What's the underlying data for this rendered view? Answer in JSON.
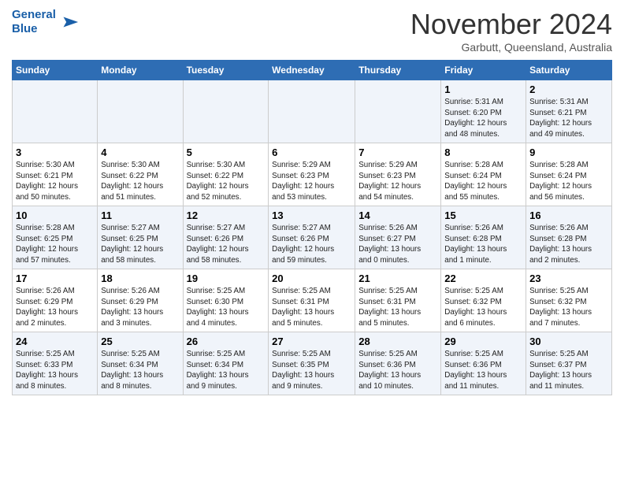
{
  "logo": {
    "line1": "General",
    "line2": "Blue"
  },
  "title": "November 2024",
  "location": "Garbutt, Queensland, Australia",
  "weekdays": [
    "Sunday",
    "Monday",
    "Tuesday",
    "Wednesday",
    "Thursday",
    "Friday",
    "Saturday"
  ],
  "weeks": [
    [
      {
        "day": "",
        "info": ""
      },
      {
        "day": "",
        "info": ""
      },
      {
        "day": "",
        "info": ""
      },
      {
        "day": "",
        "info": ""
      },
      {
        "day": "",
        "info": ""
      },
      {
        "day": "1",
        "info": "Sunrise: 5:31 AM\nSunset: 6:20 PM\nDaylight: 12 hours\nand 48 minutes."
      },
      {
        "day": "2",
        "info": "Sunrise: 5:31 AM\nSunset: 6:21 PM\nDaylight: 12 hours\nand 49 minutes."
      }
    ],
    [
      {
        "day": "3",
        "info": "Sunrise: 5:30 AM\nSunset: 6:21 PM\nDaylight: 12 hours\nand 50 minutes."
      },
      {
        "day": "4",
        "info": "Sunrise: 5:30 AM\nSunset: 6:22 PM\nDaylight: 12 hours\nand 51 minutes."
      },
      {
        "day": "5",
        "info": "Sunrise: 5:30 AM\nSunset: 6:22 PM\nDaylight: 12 hours\nand 52 minutes."
      },
      {
        "day": "6",
        "info": "Sunrise: 5:29 AM\nSunset: 6:23 PM\nDaylight: 12 hours\nand 53 minutes."
      },
      {
        "day": "7",
        "info": "Sunrise: 5:29 AM\nSunset: 6:23 PM\nDaylight: 12 hours\nand 54 minutes."
      },
      {
        "day": "8",
        "info": "Sunrise: 5:28 AM\nSunset: 6:24 PM\nDaylight: 12 hours\nand 55 minutes."
      },
      {
        "day": "9",
        "info": "Sunrise: 5:28 AM\nSunset: 6:24 PM\nDaylight: 12 hours\nand 56 minutes."
      }
    ],
    [
      {
        "day": "10",
        "info": "Sunrise: 5:28 AM\nSunset: 6:25 PM\nDaylight: 12 hours\nand 57 minutes."
      },
      {
        "day": "11",
        "info": "Sunrise: 5:27 AM\nSunset: 6:25 PM\nDaylight: 12 hours\nand 58 minutes."
      },
      {
        "day": "12",
        "info": "Sunrise: 5:27 AM\nSunset: 6:26 PM\nDaylight: 12 hours\nand 58 minutes."
      },
      {
        "day": "13",
        "info": "Sunrise: 5:27 AM\nSunset: 6:26 PM\nDaylight: 12 hours\nand 59 minutes."
      },
      {
        "day": "14",
        "info": "Sunrise: 5:26 AM\nSunset: 6:27 PM\nDaylight: 13 hours\nand 0 minutes."
      },
      {
        "day": "15",
        "info": "Sunrise: 5:26 AM\nSunset: 6:28 PM\nDaylight: 13 hours\nand 1 minute."
      },
      {
        "day": "16",
        "info": "Sunrise: 5:26 AM\nSunset: 6:28 PM\nDaylight: 13 hours\nand 2 minutes."
      }
    ],
    [
      {
        "day": "17",
        "info": "Sunrise: 5:26 AM\nSunset: 6:29 PM\nDaylight: 13 hours\nand 2 minutes."
      },
      {
        "day": "18",
        "info": "Sunrise: 5:26 AM\nSunset: 6:29 PM\nDaylight: 13 hours\nand 3 minutes."
      },
      {
        "day": "19",
        "info": "Sunrise: 5:25 AM\nSunset: 6:30 PM\nDaylight: 13 hours\nand 4 minutes."
      },
      {
        "day": "20",
        "info": "Sunrise: 5:25 AM\nSunset: 6:31 PM\nDaylight: 13 hours\nand 5 minutes."
      },
      {
        "day": "21",
        "info": "Sunrise: 5:25 AM\nSunset: 6:31 PM\nDaylight: 13 hours\nand 5 minutes."
      },
      {
        "day": "22",
        "info": "Sunrise: 5:25 AM\nSunset: 6:32 PM\nDaylight: 13 hours\nand 6 minutes."
      },
      {
        "day": "23",
        "info": "Sunrise: 5:25 AM\nSunset: 6:32 PM\nDaylight: 13 hours\nand 7 minutes."
      }
    ],
    [
      {
        "day": "24",
        "info": "Sunrise: 5:25 AM\nSunset: 6:33 PM\nDaylight: 13 hours\nand 8 minutes."
      },
      {
        "day": "25",
        "info": "Sunrise: 5:25 AM\nSunset: 6:34 PM\nDaylight: 13 hours\nand 8 minutes."
      },
      {
        "day": "26",
        "info": "Sunrise: 5:25 AM\nSunset: 6:34 PM\nDaylight: 13 hours\nand 9 minutes."
      },
      {
        "day": "27",
        "info": "Sunrise: 5:25 AM\nSunset: 6:35 PM\nDaylight: 13 hours\nand 9 minutes."
      },
      {
        "day": "28",
        "info": "Sunrise: 5:25 AM\nSunset: 6:36 PM\nDaylight: 13 hours\nand 10 minutes."
      },
      {
        "day": "29",
        "info": "Sunrise: 5:25 AM\nSunset: 6:36 PM\nDaylight: 13 hours\nand 11 minutes."
      },
      {
        "day": "30",
        "info": "Sunrise: 5:25 AM\nSunset: 6:37 PM\nDaylight: 13 hours\nand 11 minutes."
      }
    ]
  ]
}
